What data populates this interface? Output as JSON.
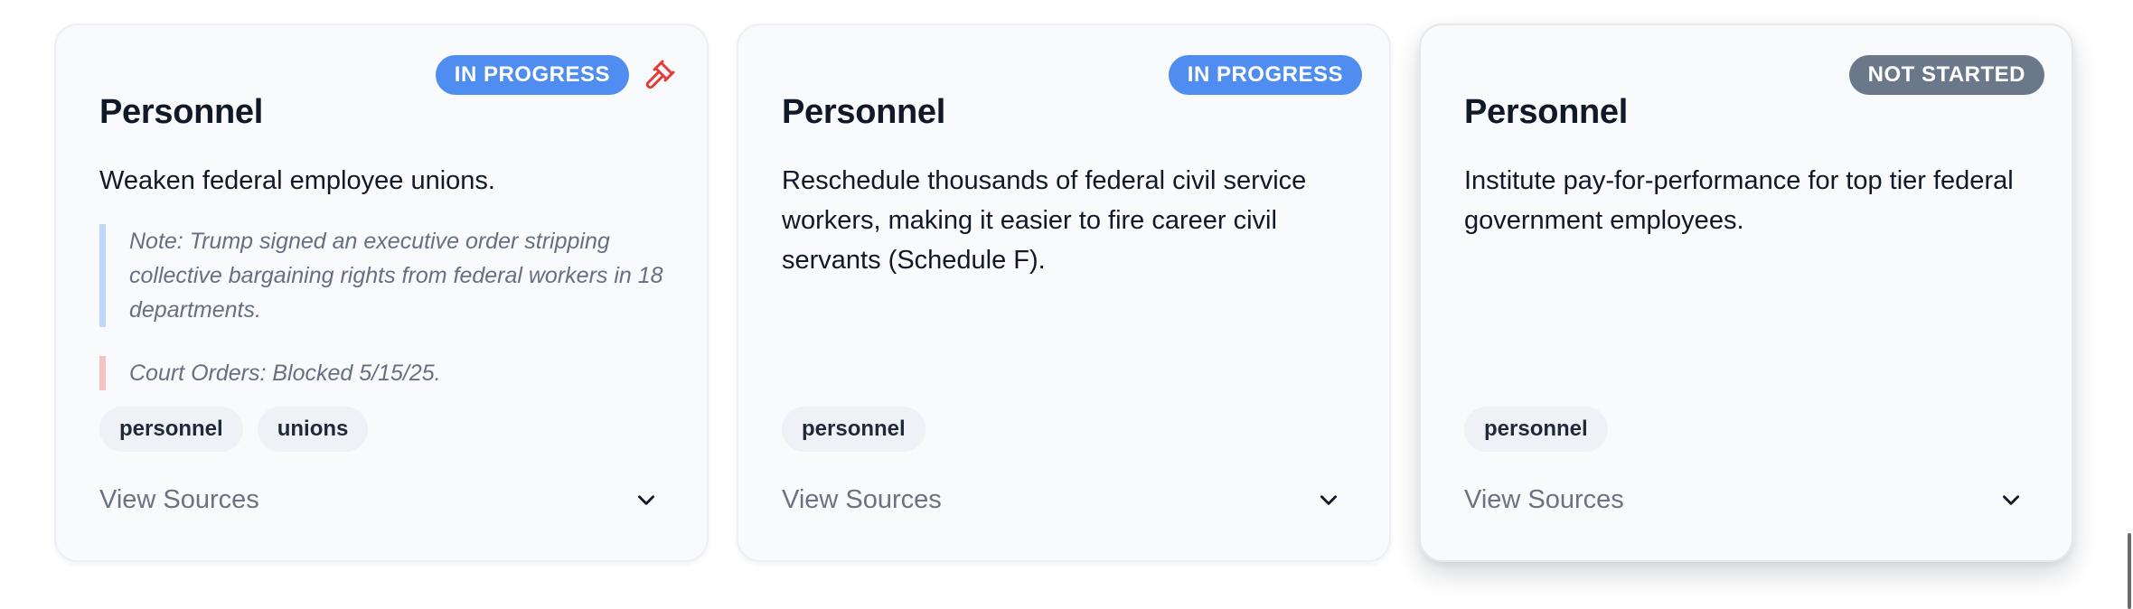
{
  "cards": [
    {
      "title": "Personnel",
      "status": "IN PROGRESS",
      "status_icon": "gavel-icon",
      "description": "Weaken federal employee unions.",
      "note": "Note: Trump signed an executive order stripping collective bargaining rights from federal workers in 18 departments.",
      "court": "Court Orders: Blocked 5/15/25.",
      "tags": [
        "personnel",
        "unions"
      ],
      "sources_label": "View Sources"
    },
    {
      "title": "Personnel",
      "status": "IN PROGRESS",
      "description": "Reschedule thousands of federal civil service workers, making it easier to fire career civil servants (Schedule F).",
      "tags": [
        "personnel"
      ],
      "sources_label": "View Sources"
    },
    {
      "title": "Personnel",
      "status": "NOT STARTED",
      "description": "Institute pay-for-performance for top tier federal government employees.",
      "tags": [
        "personnel"
      ],
      "sources_label": "View Sources"
    }
  ],
  "colors": {
    "in_progress": "#4f8ef0",
    "not_started": "#6b7889",
    "gavel": "#e53935",
    "note_border": "#bfd6fb",
    "court_border": "#f9c2c2"
  }
}
